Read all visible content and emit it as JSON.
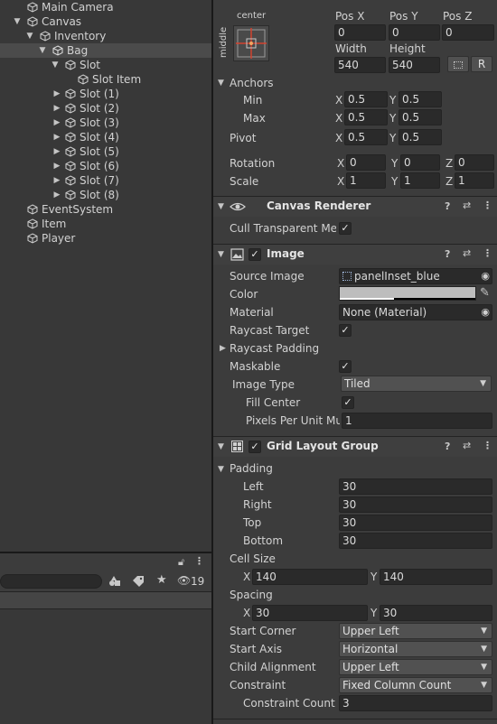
{
  "hierarchy": {
    "items": [
      {
        "label": "Main Camera"
      },
      {
        "label": "Canvas"
      },
      {
        "label": "Inventory"
      },
      {
        "label": "Bag"
      },
      {
        "label": "Slot"
      },
      {
        "label": "Slot Item"
      },
      {
        "label": "Slot (1)"
      },
      {
        "label": "Slot (2)"
      },
      {
        "label": "Slot (3)"
      },
      {
        "label": "Slot (4)"
      },
      {
        "label": "Slot (5)"
      },
      {
        "label": "Slot (6)"
      },
      {
        "label": "Slot (7)"
      },
      {
        "label": "Slot (8)"
      },
      {
        "label": "EventSystem"
      },
      {
        "label": "Item"
      },
      {
        "label": "Player"
      }
    ],
    "bottom_panel": {
      "hidden_count": "19"
    }
  },
  "rect_transform": {
    "anchor_top_label": "center",
    "anchor_side_label": "middle",
    "posx_label": "Pos X",
    "posy_label": "Pos Y",
    "posz_label": "Pos Z",
    "posx": "0",
    "posy": "0",
    "posz": "0",
    "width_label": "Width",
    "height_label": "Height",
    "width": "540",
    "height": "540",
    "raw_button": "R",
    "anchors_label": "Anchors",
    "min_label": "Min",
    "max_label": "Max",
    "min_x": "0.5",
    "min_y": "0.5",
    "max_x": "0.5",
    "max_y": "0.5",
    "pivot_label": "Pivot",
    "pivot_x": "0.5",
    "pivot_y": "0.5",
    "rotation_label": "Rotation",
    "rot_x": "0",
    "rot_y": "0",
    "rot_z": "0",
    "scale_label": "Scale",
    "scale_x": "1",
    "scale_y": "1",
    "scale_z": "1",
    "axis_x": "X",
    "axis_y": "Y",
    "axis_z": "Z"
  },
  "canvas_renderer": {
    "title": "Canvas Renderer",
    "cull_label": "Cull Transparent Mes",
    "cull_checked": true
  },
  "image": {
    "title": "Image",
    "source_label": "Source Image",
    "source_value": "panelInset_blue",
    "color_label": "Color",
    "color_value": "#bdbdbd",
    "material_label": "Material",
    "material_value": "None (Material)",
    "raycast_target_label": "Raycast Target",
    "raycast_padding_label": "Raycast Padding",
    "maskable_label": "Maskable",
    "image_type_label": "Image Type",
    "image_type_value": "Tiled",
    "fill_center_label": "Fill Center",
    "ppu_label": "Pixels Per Unit Mul",
    "ppu_value": "1"
  },
  "grid": {
    "title": "Grid Layout Group",
    "padding_label": "Padding",
    "left_label": "Left",
    "left": "30",
    "right_label": "Right",
    "right": "30",
    "top_label": "Top",
    "top": "30",
    "bottom_label": "Bottom",
    "bottom": "30",
    "cell_size_label": "Cell Size",
    "cell_x": "140",
    "cell_y": "140",
    "spacing_label": "Spacing",
    "spacing_x": "30",
    "spacing_y": "30",
    "start_corner_label": "Start Corner",
    "start_corner": "Upper Left",
    "start_axis_label": "Start Axis",
    "start_axis": "Horizontal",
    "child_alignment_label": "Child Alignment",
    "child_alignment": "Upper Left",
    "constraint_label": "Constraint",
    "constraint": "Fixed Column Count",
    "constraint_count_label": "Constraint Count",
    "constraint_count": "3"
  },
  "colors": {
    "selected_row": "#4b4b4b",
    "background": "#383838",
    "field": "#2a2a2a",
    "anchor_accent": "#d3432e",
    "anchor_dot": "#f4a460"
  }
}
